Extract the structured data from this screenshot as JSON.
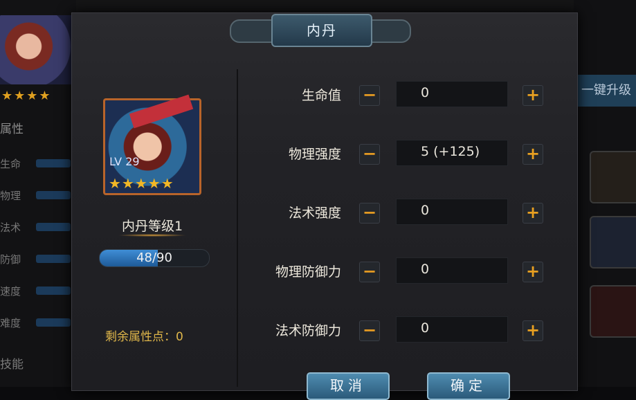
{
  "background": {
    "left_stars": "★★★★",
    "section_attributes": "属性",
    "stats": [
      "生命",
      "物理",
      "法术",
      "防御",
      "速度",
      "难度"
    ],
    "section_skills": "技能",
    "onekey_button": "一键升级"
  },
  "dialog": {
    "title": "内丹",
    "hero": {
      "level_text": "LV 29",
      "stars": "★★★★★"
    },
    "level_label": "内丹等级1",
    "xp": {
      "current": 48,
      "max": 90,
      "text": "48/90",
      "fill_fraction": 0.53
    },
    "remaining_points_label": "剩余属性点：0",
    "attributes": [
      {
        "label": "生命值",
        "value": "0"
      },
      {
        "label": "物理强度",
        "value": "5 (+125)"
      },
      {
        "label": "法术强度",
        "value": "0"
      },
      {
        "label": "物理防御力",
        "value": "0"
      },
      {
        "label": "法术防御力",
        "value": "0"
      }
    ],
    "minus_symbol": "−",
    "plus_symbol": "+",
    "cancel_button": "取消",
    "confirm_button": "确定"
  },
  "colors": {
    "accent_orange": "#e8a021",
    "xp_blue": "#3f8ed6",
    "points_gold": "#e0b74a"
  }
}
